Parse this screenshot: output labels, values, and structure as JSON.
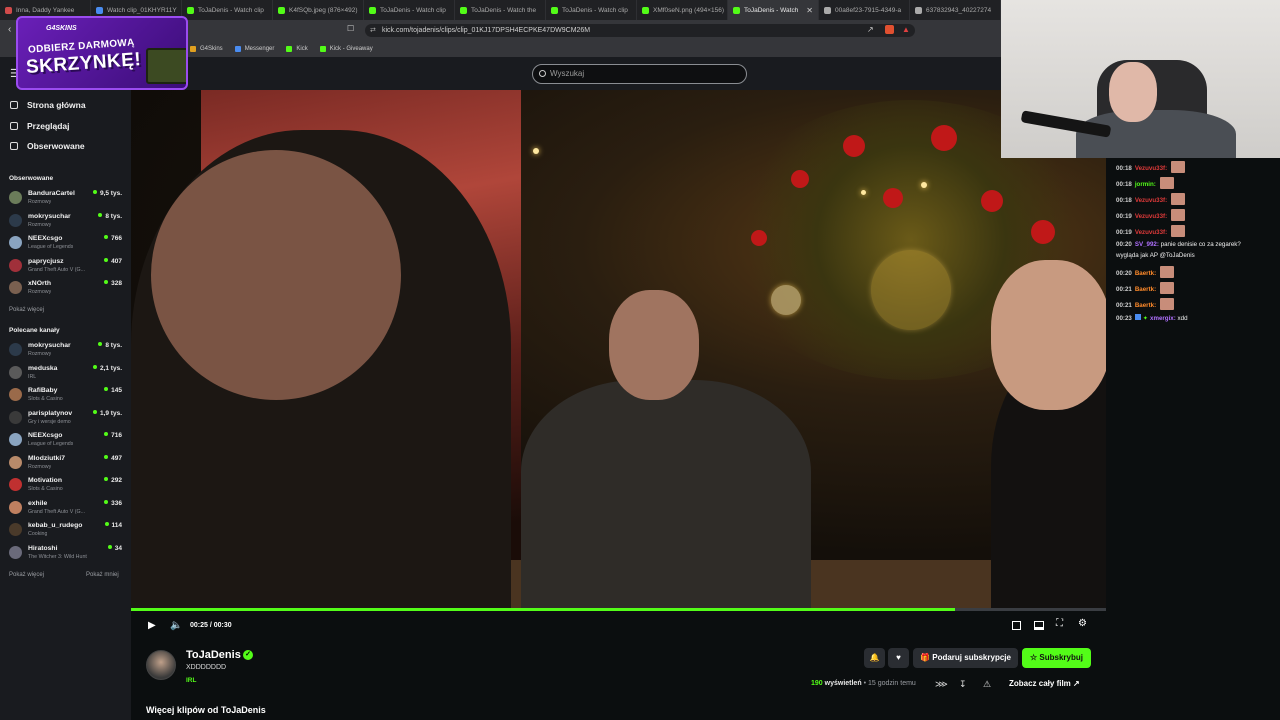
{
  "browser": {
    "tabs": [
      {
        "label": "Inna, Daddy Yankee",
        "color": "#d14b4b"
      },
      {
        "label": "Watch clip_01KHYR11Y",
        "color": "#4a8cf0"
      },
      {
        "label": "ToJaDenis - Watch clip",
        "color": "#53fc18"
      },
      {
        "label": "K4fSQb.jpeg (876×492)",
        "color": "#53fc18"
      },
      {
        "label": "ToJaDenis - Watch clip",
        "color": "#53fc18"
      },
      {
        "label": "ToJaDenis - Watch the",
        "color": "#53fc18"
      },
      {
        "label": "ToJaDenis - Watch clip",
        "color": "#53fc18"
      },
      {
        "label": "XMf0seN.png (494×156)",
        "color": "#53fc18"
      },
      {
        "label": "ToJaDenis - Watch",
        "color": "#53fc18",
        "active": true
      },
      {
        "label": "00a8ef23-7915-4349-a",
        "color": "#aaaaaa"
      },
      {
        "label": "637832943_40227274",
        "color": "#aaaaaa"
      }
    ],
    "close_glyph": "✕",
    "url": "kick.com/tojadenis/clips/clip_01KJ17DPSH4ECPKE47DW9CM26M",
    "bookmarks": [
      {
        "label": "G4Skins",
        "color": "#e0a020"
      },
      {
        "label": "Messenger",
        "color": "#4a8cf0"
      },
      {
        "label": "Kick",
        "color": "#53fc18"
      },
      {
        "label": "Kick - Giveaway",
        "color": "#53fc18"
      }
    ]
  },
  "promo": {
    "brand": "G4SKINS",
    "line1": "ODBIERZ DARMOWĄ",
    "line2": "SKRZYNKĘ!"
  },
  "header": {
    "search_placeholder": "Wyszukaj"
  },
  "sidebar": {
    "nav": [
      {
        "label": "Strona główna",
        "icon": "home-icon"
      },
      {
        "label": "Przeglądaj",
        "icon": "browse-icon"
      },
      {
        "label": "Obserwowane",
        "icon": "heart-icon"
      }
    ],
    "followed_title": "Obserwowane",
    "followed": [
      {
        "name": "BanduraCartel",
        "category": "Rozmowy",
        "viewers": "9,5 tys.",
        "color": "#6b7c5a"
      },
      {
        "name": "mokrysuchar",
        "category": "Rozmowy",
        "viewers": "8 tys.",
        "color": "#2c3a4a"
      },
      {
        "name": "NEEXcsgo",
        "category": "League of Legends",
        "viewers": "766",
        "color": "#8aa4c0"
      },
      {
        "name": "paprycjusz",
        "category": "Grand Theft Auto V (G...",
        "viewers": "407",
        "color": "#a0303a"
      },
      {
        "name": "xNOrth",
        "category": "Rozmowy",
        "viewers": "328",
        "color": "#7a6050"
      }
    ],
    "show_more": "Pokaż więcej",
    "recommended_title": "Polecane kanały",
    "recommended": [
      {
        "name": "mokrysuchar",
        "category": "Rozmowy",
        "viewers": "8 tys.",
        "color": "#2c3a4a"
      },
      {
        "name": "meduska",
        "category": "IRL",
        "viewers": "2,1 tys.",
        "color": "#5a5a5a"
      },
      {
        "name": "RafiBaby",
        "category": "Slots & Casino",
        "viewers": "145",
        "color": "#9a6a4a"
      },
      {
        "name": "parisplatynov",
        "category": "Gry i wersje demo",
        "viewers": "1,9 tys.",
        "color": "#3a3a3a"
      },
      {
        "name": "NEEXcsgo",
        "category": "League of Legends",
        "viewers": "716",
        "color": "#8aa4c0"
      },
      {
        "name": "Mlodziutki7",
        "category": "Rozmowy",
        "viewers": "497",
        "color": "#b88a6a"
      },
      {
        "name": "Motivation",
        "category": "Slots & Casino",
        "viewers": "292",
        "color": "#c03030"
      },
      {
        "name": "exhile",
        "category": "Grand Theft Auto V (G...",
        "viewers": "336",
        "color": "#c08060"
      },
      {
        "name": "kebab_u_rudego",
        "category": "Cooking",
        "viewers": "114",
        "color": "#4a3a2a"
      },
      {
        "name": "Hiratoshi",
        "category": "The Witcher 3: Wild Hunt",
        "viewers": "34",
        "color": "#6a6a7a"
      }
    ],
    "show_more_2": "Pokaż więcej",
    "show_less": "Pokaż mniej"
  },
  "player": {
    "time": "00:25 / 00:30",
    "progress": 0.845,
    "icons": [
      "play-icon",
      "volume-icon",
      "miniplayer-icon",
      "theater-icon",
      "fullscreen-icon",
      "settings-icon"
    ]
  },
  "clip": {
    "channel": "ToJaDenis",
    "title": "XDDDDDDD",
    "category": "IRL",
    "gift_label": "Podaruj subskrypcje",
    "subscribe_label": "Subskrybuj",
    "views": "190",
    "views_label": "wyświetleń",
    "age": "• 15 godzin temu",
    "watch_full": "Zobacz cały film",
    "more_clips": "Więcej klipów od ToJaDenis"
  },
  "chat": {
    "messages": [
      {
        "time": "00:18",
        "user": "Vezuvu33f:",
        "color": "#e03a3a",
        "text": "",
        "emote": true
      },
      {
        "time": "00:18",
        "user": "jormin:",
        "color": "#53fc18",
        "text": "",
        "emote": true
      },
      {
        "time": "00:18",
        "user": "Vezuvu33f:",
        "color": "#e03a3a",
        "text": "",
        "emote": true
      },
      {
        "time": "00:19",
        "user": "Vezuvu33f:",
        "color": "#e03a3a",
        "text": "",
        "emote": true
      },
      {
        "time": "00:19",
        "user": "Vezuvu33f:",
        "color": "#e03a3a",
        "text": "",
        "emote": true
      },
      {
        "time": "00:20",
        "user": "SV_992:",
        "color": "#b070ff",
        "text": "panie denisie co za zegarek?",
        "emote": false
      },
      {
        "time": "",
        "user": "",
        "color": "#e8e8e8",
        "text": "wygląda jak AP @ToJaDenis",
        "emote": false
      },
      {
        "time": "00:20",
        "user": "Baertk:",
        "color": "#ff8a2a",
        "text": "",
        "emote": true
      },
      {
        "time": "00:21",
        "user": "Baertk:",
        "color": "#ff8a2a",
        "text": "",
        "emote": true
      },
      {
        "time": "00:21",
        "user": "Baertk:",
        "color": "#ff8a2a",
        "text": "",
        "emote": true
      },
      {
        "time": "00:23",
        "user": "xmergix:",
        "color": "#b070ff",
        "text": "xdd",
        "emote": false
      }
    ]
  }
}
